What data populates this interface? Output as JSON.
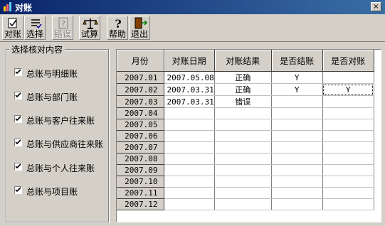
{
  "window": {
    "title": "对账",
    "close_label": "×"
  },
  "toolbar": {
    "buttons": [
      {
        "label": "对账",
        "icon": "reconcile-icon",
        "enabled": true
      },
      {
        "label": "选择",
        "icon": "list-icon",
        "enabled": true
      },
      {
        "label": "错误",
        "icon": "error-icon",
        "enabled": false
      },
      {
        "label": "试算",
        "icon": "scale-icon",
        "enabled": true
      },
      {
        "label": "帮助",
        "icon": "help-icon",
        "enabled": true
      },
      {
        "label": "退出",
        "icon": "exit-icon",
        "enabled": true
      }
    ]
  },
  "options": {
    "legend": "选择核对内容",
    "items": [
      {
        "label": "总账与明细账",
        "checked": true
      },
      {
        "label": "总账与部门账",
        "checked": true
      },
      {
        "label": "总账与客户往来账",
        "checked": true
      },
      {
        "label": "总账与供应商往来账",
        "checked": true
      },
      {
        "label": "总账与个人往来账",
        "checked": true
      },
      {
        "label": "总账与项目账",
        "checked": true
      }
    ]
  },
  "grid": {
    "columns": [
      "月份",
      "对账日期",
      "对账结果",
      "是否结账",
      "是否对账"
    ],
    "rows": [
      [
        "2007.01",
        "2007.05.08",
        "正确",
        "Y",
        ""
      ],
      [
        "2007.02",
        "2007.03.31",
        "正确",
        "Y",
        "Y"
      ],
      [
        "2007.03",
        "2007.03.31",
        "错误",
        "",
        ""
      ],
      [
        "2007.04",
        "",
        "",
        "",
        ""
      ],
      [
        "2007.05",
        "",
        "",
        "",
        ""
      ],
      [
        "2007.06",
        "",
        "",
        "",
        ""
      ],
      [
        "2007.07",
        "",
        "",
        "",
        ""
      ],
      [
        "2007.08",
        "",
        "",
        "",
        ""
      ],
      [
        "2007.09",
        "",
        "",
        "",
        ""
      ],
      [
        "2007.10",
        "",
        "",
        "",
        ""
      ],
      [
        "2007.11",
        "",
        "",
        "",
        ""
      ],
      [
        "2007.12",
        "",
        "",
        "",
        ""
      ]
    ]
  }
}
